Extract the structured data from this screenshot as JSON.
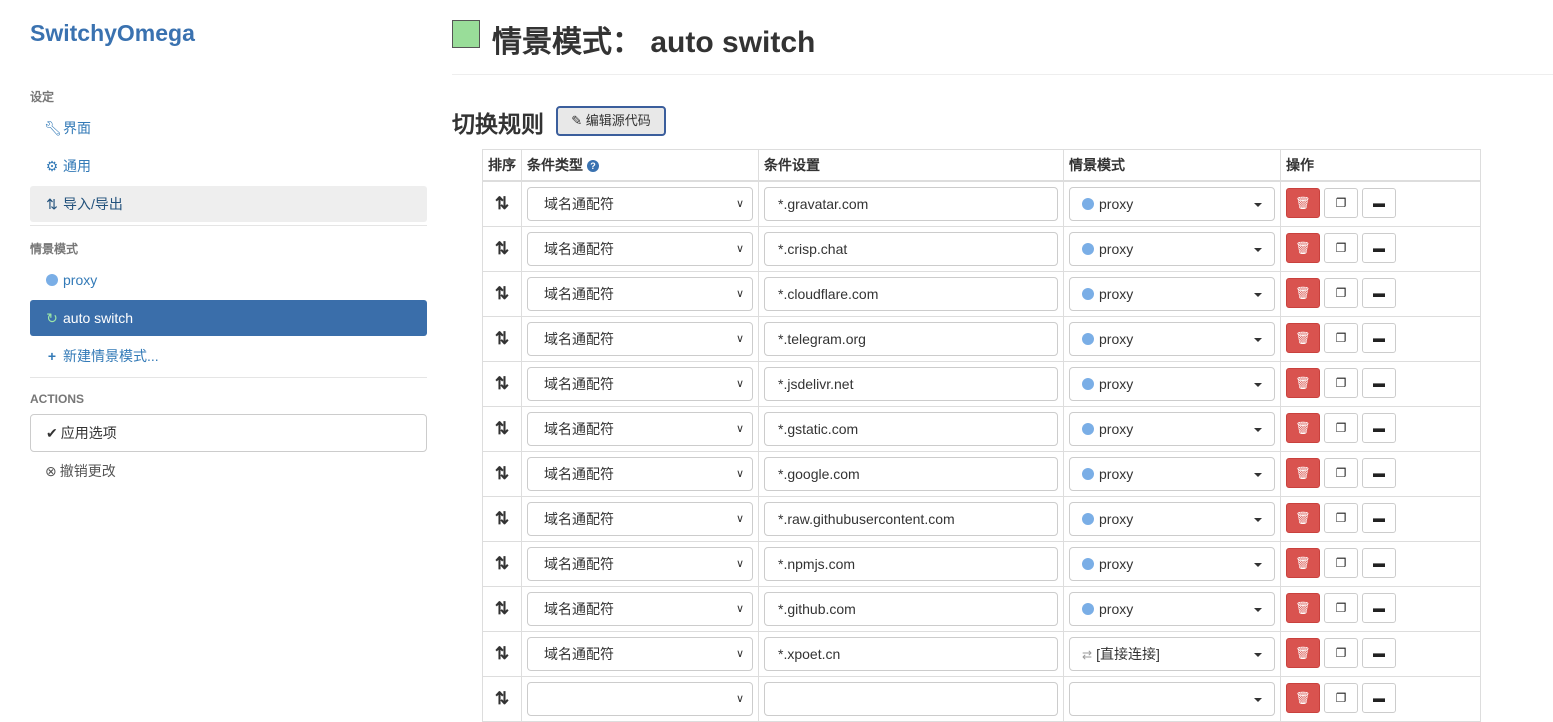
{
  "brand": "SwitchyOmega",
  "sidebar": {
    "settings_header": "设定",
    "settings_items": [
      {
        "label": "界面",
        "icon": "wrench-icon"
      },
      {
        "label": "通用",
        "icon": "gear-icon"
      },
      {
        "label": "导入/导出",
        "icon": "import-export-icon"
      }
    ],
    "profiles_header": "情景模式",
    "profiles": [
      {
        "label": "proxy",
        "icon": "globe-icon"
      },
      {
        "label": "auto switch",
        "icon": "auto-switch-icon"
      }
    ],
    "new_profile": "新建情景模式...",
    "actions_header": "ACTIONS",
    "apply_label": "应用选项",
    "discard_label": "撤销更改"
  },
  "page": {
    "title_prefix": "情景模式：",
    "title_name": "auto switch",
    "swatch_color": "#99dd99"
  },
  "section": {
    "title": "切换规则",
    "edit_source_label": "编辑源代码"
  },
  "table": {
    "headers": {
      "sort": "排序",
      "type": "条件类型",
      "setting": "条件设置",
      "profile": "情景模式",
      "actions": "操作"
    },
    "rows": [
      {
        "type": "域名通配符",
        "pattern": "*.gravatar.com",
        "profile": "proxy",
        "profile_icon": "globe-icon"
      },
      {
        "type": "域名通配符",
        "pattern": "*.crisp.chat",
        "profile": "proxy",
        "profile_icon": "globe-icon"
      },
      {
        "type": "域名通配符",
        "pattern": "*.cloudflare.com",
        "profile": "proxy",
        "profile_icon": "globe-icon"
      },
      {
        "type": "域名通配符",
        "pattern": "*.telegram.org",
        "profile": "proxy",
        "profile_icon": "globe-icon"
      },
      {
        "type": "域名通配符",
        "pattern": "*.jsdelivr.net",
        "profile": "proxy",
        "profile_icon": "globe-icon"
      },
      {
        "type": "域名通配符",
        "pattern": "*.gstatic.com",
        "profile": "proxy",
        "profile_icon": "globe-icon"
      },
      {
        "type": "域名通配符",
        "pattern": "*.google.com",
        "profile": "proxy",
        "profile_icon": "globe-icon"
      },
      {
        "type": "域名通配符",
        "pattern": "*.raw.githubusercontent.com",
        "profile": "proxy",
        "profile_icon": "globe-icon"
      },
      {
        "type": "域名通配符",
        "pattern": "*.npmjs.com",
        "profile": "proxy",
        "profile_icon": "globe-icon"
      },
      {
        "type": "域名通配符",
        "pattern": "*.github.com",
        "profile": "proxy",
        "profile_icon": "globe-icon"
      },
      {
        "type": "域名通配符",
        "pattern": "*.xpoet.cn",
        "profile": "[直接连接]",
        "profile_icon": "direct-icon"
      },
      {
        "type": "",
        "pattern": "",
        "profile": "",
        "profile_icon": ""
      }
    ]
  },
  "colors": {
    "accent": "#3a72b0",
    "active_bg": "#3a6eaa",
    "danger": "#d9534f"
  }
}
